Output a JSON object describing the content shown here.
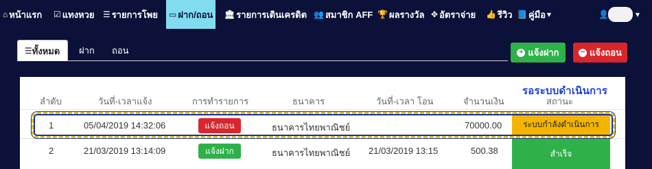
{
  "nav": {
    "items": [
      {
        "icon": "home-icon",
        "glyph": "⌂",
        "label": "หน้าแรก"
      },
      {
        "icon": "check-square-icon",
        "glyph": "☑",
        "label": "แทงหวย"
      },
      {
        "icon": "list-icon",
        "glyph": "☰",
        "label": "รายการโพย"
      },
      {
        "icon": "money-icon",
        "glyph": "▭",
        "label": "ฝาก/ถอน"
      },
      {
        "icon": "bank-icon",
        "glyph": "🏛",
        "label": "รายการเดินเครดิต"
      },
      {
        "icon": "users-icon",
        "glyph": "👥",
        "label": "สมาชิก AFF"
      },
      {
        "icon": "trophy-icon",
        "glyph": "🏆",
        "label": "ผลรางวัล"
      },
      {
        "icon": "rate-icon",
        "glyph": "✥",
        "label": "อัตราจ่าย"
      },
      {
        "icon": "thumbs-up-icon",
        "glyph": "👍",
        "label": "รีวิว"
      },
      {
        "icon": "book-icon",
        "glyph": "📘",
        "label": "คู่มือ"
      }
    ],
    "manual_chevron": "▾",
    "user_glyph": "👤",
    "user_chevron": "▾"
  },
  "tabs": [
    {
      "label": "ทั้งหมด",
      "glyph": "☰"
    },
    {
      "label": "ฝาก"
    },
    {
      "label": "ถอน"
    }
  ],
  "actions": {
    "deposit_label": "แจ้งฝาก",
    "deposit_glyph": "+",
    "withdraw_label": "แจ้งถอน",
    "withdraw_glyph": "−"
  },
  "table": {
    "headers": [
      "ลำดับ",
      "วันที่-เวลาแจ้ง",
      "การทำรายการ",
      "ธนาคาร",
      "วันที่-เวลา โอน",
      "จำนวนเงิน",
      "สถานะ"
    ],
    "rows": [
      {
        "no": "1",
        "requested": "05/04/2019 14:32:06",
        "type": "แจ้งถอน",
        "bank": "ธนาคารไทยพาณิชย์",
        "transferred": "",
        "amount": "70000.00",
        "status": "ระบบกำลังดำเนินการ"
      },
      {
        "no": "2",
        "requested": "21/03/2019 13:14:09",
        "type": "แจ้งฝาก",
        "bank": "ธนาคารไทยพาณิชย์",
        "transferred": "21/03/2019 13:15",
        "amount": "500.38",
        "status": "สำเร็จ"
      }
    ]
  },
  "callout": {
    "label": "รอระบบดำเนินการ"
  },
  "colors": {
    "navbar": "#0b1138",
    "active_nav": "#82dcf0",
    "green": "#2fb14a",
    "red": "#d8262c",
    "pending": "#f4b400",
    "callout_text": "#1f3fd7",
    "callout_border": "#e1c31f"
  }
}
